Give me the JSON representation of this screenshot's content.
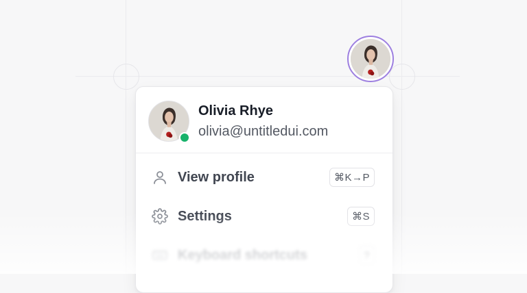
{
  "trigger": {
    "avatar_ring_color": "#9d7fe0",
    "icon": "user-avatar"
  },
  "user": {
    "name": "Olivia Rhye",
    "email": "olivia@untitledui.com",
    "status_color": "#17b26a"
  },
  "menu": {
    "items": [
      {
        "icon": "user-icon",
        "label": "View profile",
        "shortcut": "⌘K→P"
      },
      {
        "icon": "gear-icon",
        "label": "Settings",
        "shortcut": "⌘S"
      },
      {
        "icon": "keyboard-icon",
        "label": "Keyboard shortcuts",
        "shortcut": "?"
      }
    ]
  }
}
